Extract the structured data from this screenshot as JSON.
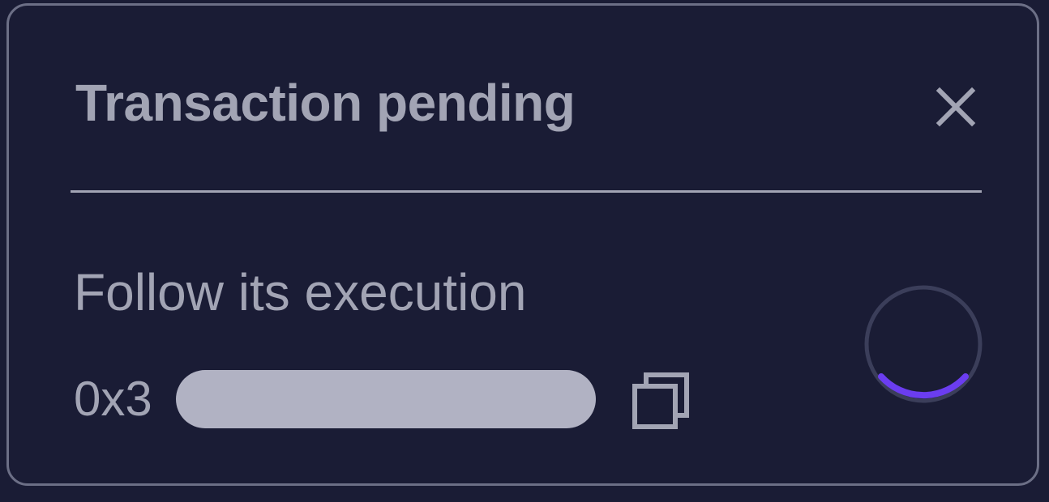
{
  "notification": {
    "title": "Transaction pending",
    "subtitle": "Follow its execution",
    "hash_prefix": "0x3",
    "close_icon": "close-icon",
    "copy_icon": "copy-icon",
    "status": "pending",
    "colors": {
      "background": "#1a1c35",
      "border": "#6c6f86",
      "text": "#a2a4b4",
      "redaction": "#b1b2c3",
      "spinner_track": "#3b3e5a",
      "spinner_accent": "#6b3df0"
    }
  }
}
